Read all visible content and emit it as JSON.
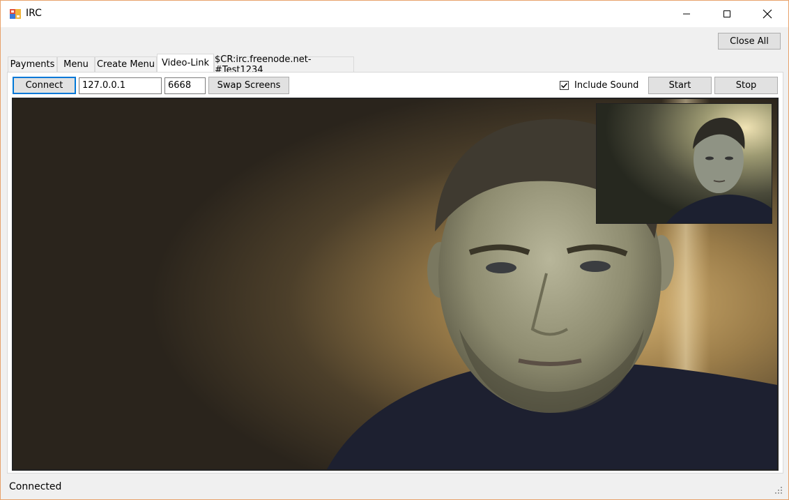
{
  "window": {
    "title": "IRC"
  },
  "title_bar": {
    "minimize_icon": "minimize-icon",
    "maximize_icon": "maximize-icon",
    "close_icon": "close-icon"
  },
  "toolbar": {
    "close_all_label": "Close All"
  },
  "tabs": [
    {
      "label": "Payments"
    },
    {
      "label": "Menu"
    },
    {
      "label": "Create Menu"
    },
    {
      "label": "Video-Link",
      "active": true
    },
    {
      "label": "$CR:irc.freenode.net-#Test1234"
    }
  ],
  "video_link": {
    "connect_label": "Connect",
    "ip_value": "127.0.0.1",
    "port_value": "6668",
    "swap_label": "Swap Screens",
    "include_sound_label": "Include Sound",
    "include_sound_checked": true,
    "start_label": "Start",
    "stop_label": "Stop"
  },
  "status": {
    "text": "Connected"
  },
  "colors": {
    "focus_border": "#0078d7",
    "window_border": "#e8a26b"
  }
}
